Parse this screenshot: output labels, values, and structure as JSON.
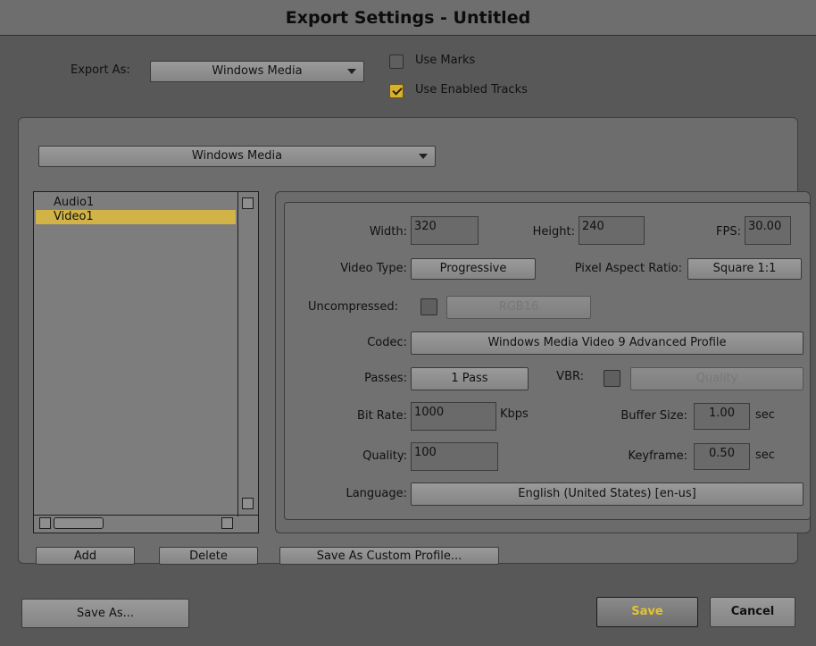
{
  "window": {
    "title": "Export Settings - Untitled"
  },
  "export_as": {
    "label": "Export As:",
    "value": "Windows Media"
  },
  "use_marks": {
    "label": "Use Marks",
    "checked": false
  },
  "use_enabled_tracks": {
    "label": "Use Enabled Tracks",
    "checked": true
  },
  "format_dropdown": {
    "value": "Windows Media"
  },
  "tracks": [
    {
      "label": "Audio1",
      "selected": false
    },
    {
      "label": "Video1",
      "selected": true
    }
  ],
  "settings": {
    "width": {
      "label": "Width:",
      "value": "320"
    },
    "height": {
      "label": "Height:",
      "value": "240"
    },
    "fps": {
      "label": "FPS:",
      "value": "30.00"
    },
    "video_type": {
      "label": "Video Type:",
      "value": "Progressive"
    },
    "pixel_aspect_ratio": {
      "label": "Pixel Aspect Ratio:",
      "value": "Square 1:1"
    },
    "uncompressed": {
      "label": "Uncompressed:",
      "checked": false,
      "value": "RGB16"
    },
    "codec": {
      "label": "Codec:",
      "value": "Windows Media Video 9 Advanced Profile"
    },
    "passes": {
      "label": "Passes:",
      "value": "1 Pass"
    },
    "vbr": {
      "label": "VBR:",
      "checked": false,
      "value": "Quality"
    },
    "bit_rate": {
      "label": "Bit Rate:",
      "value": "1000",
      "unit": "Kbps"
    },
    "buffer_size": {
      "label": "Buffer Size:",
      "value": "1.00",
      "unit": "sec"
    },
    "quality": {
      "label": "Quality:",
      "value": "100"
    },
    "keyframe": {
      "label": "Keyframe:",
      "value": "0.50",
      "unit": "sec"
    },
    "language": {
      "label": "Language:",
      "value": "English (United States) [en-us]"
    }
  },
  "buttons": {
    "add": "Add",
    "delete": "Delete",
    "save_custom_profile": "Save As Custom Profile...",
    "save_as": "Save As...",
    "save": "Save",
    "cancel": "Cancel"
  },
  "colors": {
    "accent": "#d8b12e",
    "selection": "#d2b347",
    "background": "#585858"
  }
}
